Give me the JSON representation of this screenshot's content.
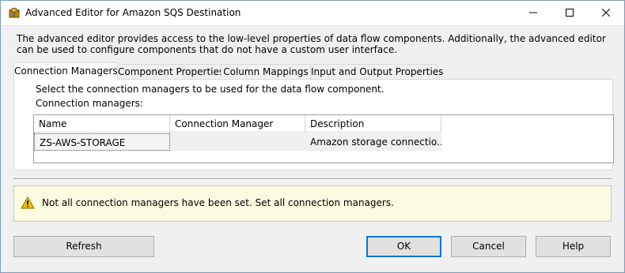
{
  "window": {
    "title": "Advanced Editor for Amazon SQS Destination",
    "minimize_glyph": "minimize-icon",
    "maximize_glyph": "maximize-icon",
    "close_glyph": "close-icon"
  },
  "intro": "The advanced editor provides access to the low-level properties of data flow components. Additionally, the advanced editor can be used to configure components that do not have a custom user interface.",
  "tabs": [
    {
      "label": "Connection Managers",
      "active": true
    },
    {
      "label": "Component Properties",
      "active": false
    },
    {
      "label": "Column Mappings",
      "active": false
    },
    {
      "label": "Input and Output Properties",
      "active": false
    }
  ],
  "panel": {
    "instruction": "Select the connection managers to be used for the data flow component.",
    "grid_label": "Connection managers:"
  },
  "grid": {
    "columns": [
      "Name",
      "Connection Manager",
      "Description"
    ],
    "rows": [
      {
        "name": "ZS-AWS-STORAGE",
        "connection_manager": "",
        "description": "Amazon storage connectio..."
      }
    ]
  },
  "warning": {
    "icon": "warning-icon",
    "text": "Not all connection managers have been set. Set all connection managers."
  },
  "buttons": {
    "refresh": "Refresh",
    "ok": "OK",
    "cancel": "Cancel",
    "help": "Help"
  },
  "colors": {
    "accent": "#0078d7",
    "warning_bg": "#fbfbe1",
    "warning_icon": "#f5c400"
  }
}
